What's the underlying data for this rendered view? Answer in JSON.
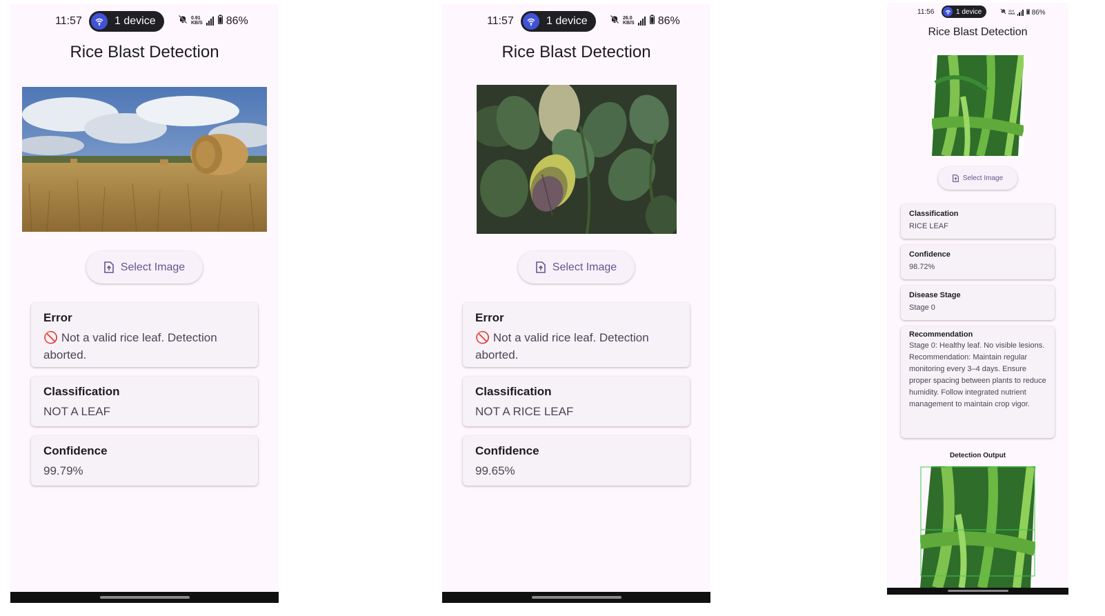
{
  "screens": [
    {
      "status": {
        "time": "11:57",
        "device_label": "1 device",
        "speed_top": "0.91",
        "speed_bottom": "KB/S",
        "battery": "86%"
      },
      "app_title": "Rice Blast Detection",
      "select_button": "Select Image",
      "cards": [
        {
          "title": "Error",
          "value": "🚫 Not a valid rice leaf. Detection aborted."
        },
        {
          "title": "Classification",
          "value": "NOT A LEAF"
        },
        {
          "title": "Confidence",
          "value": "99.79%"
        }
      ]
    },
    {
      "status": {
        "time": "11:57",
        "device_label": "1 device",
        "speed_top": "26.0",
        "speed_bottom": "KB/S",
        "battery": "86%"
      },
      "app_title": "Rice Blast Detection",
      "select_button": "Select Image",
      "cards": [
        {
          "title": "Error",
          "value": "🚫 Not a valid rice leaf. Detection aborted."
        },
        {
          "title": "Classification",
          "value": "NOT A RICE LEAF"
        },
        {
          "title": "Confidence",
          "value": "99.65%"
        }
      ]
    },
    {
      "status": {
        "time": "11:56",
        "device_label": "1 device",
        "speed_top": "12.0",
        "speed_bottom": "KB/S",
        "battery": "86%"
      },
      "app_title": "Rice Blast Detection",
      "select_button": "Select Image",
      "cards": [
        {
          "title": "Classification",
          "value": "RICE LEAF"
        },
        {
          "title": "Confidence",
          "value": "98.72%"
        },
        {
          "title": "Disease Stage",
          "value": "Stage 0"
        },
        {
          "title": "Recommendation",
          "value": "Stage 0: Healthy leaf. No visible lesions.\nRecommendation: Maintain regular monitoring every 3–4 days. Ensure proper spacing between plants to reduce humidity. Follow integrated nutrient management to maintain crop vigor."
        }
      ],
      "detection_output_label": "Detection Output"
    }
  ],
  "icons": {
    "pill": "wifi-hotspot-icon",
    "dnd": "bell-off-icon",
    "signal": "signal-bars-icon",
    "battery": "battery-icon",
    "upload": "file-upload-icon"
  },
  "colors": {
    "screen_bg": "#fef7fd",
    "card_bg": "#f7f2f7",
    "accent": "#65558f",
    "pill_bg": "#1f1f24",
    "pill_icon": "#4052d6",
    "detection_box": "#3ec94a"
  }
}
